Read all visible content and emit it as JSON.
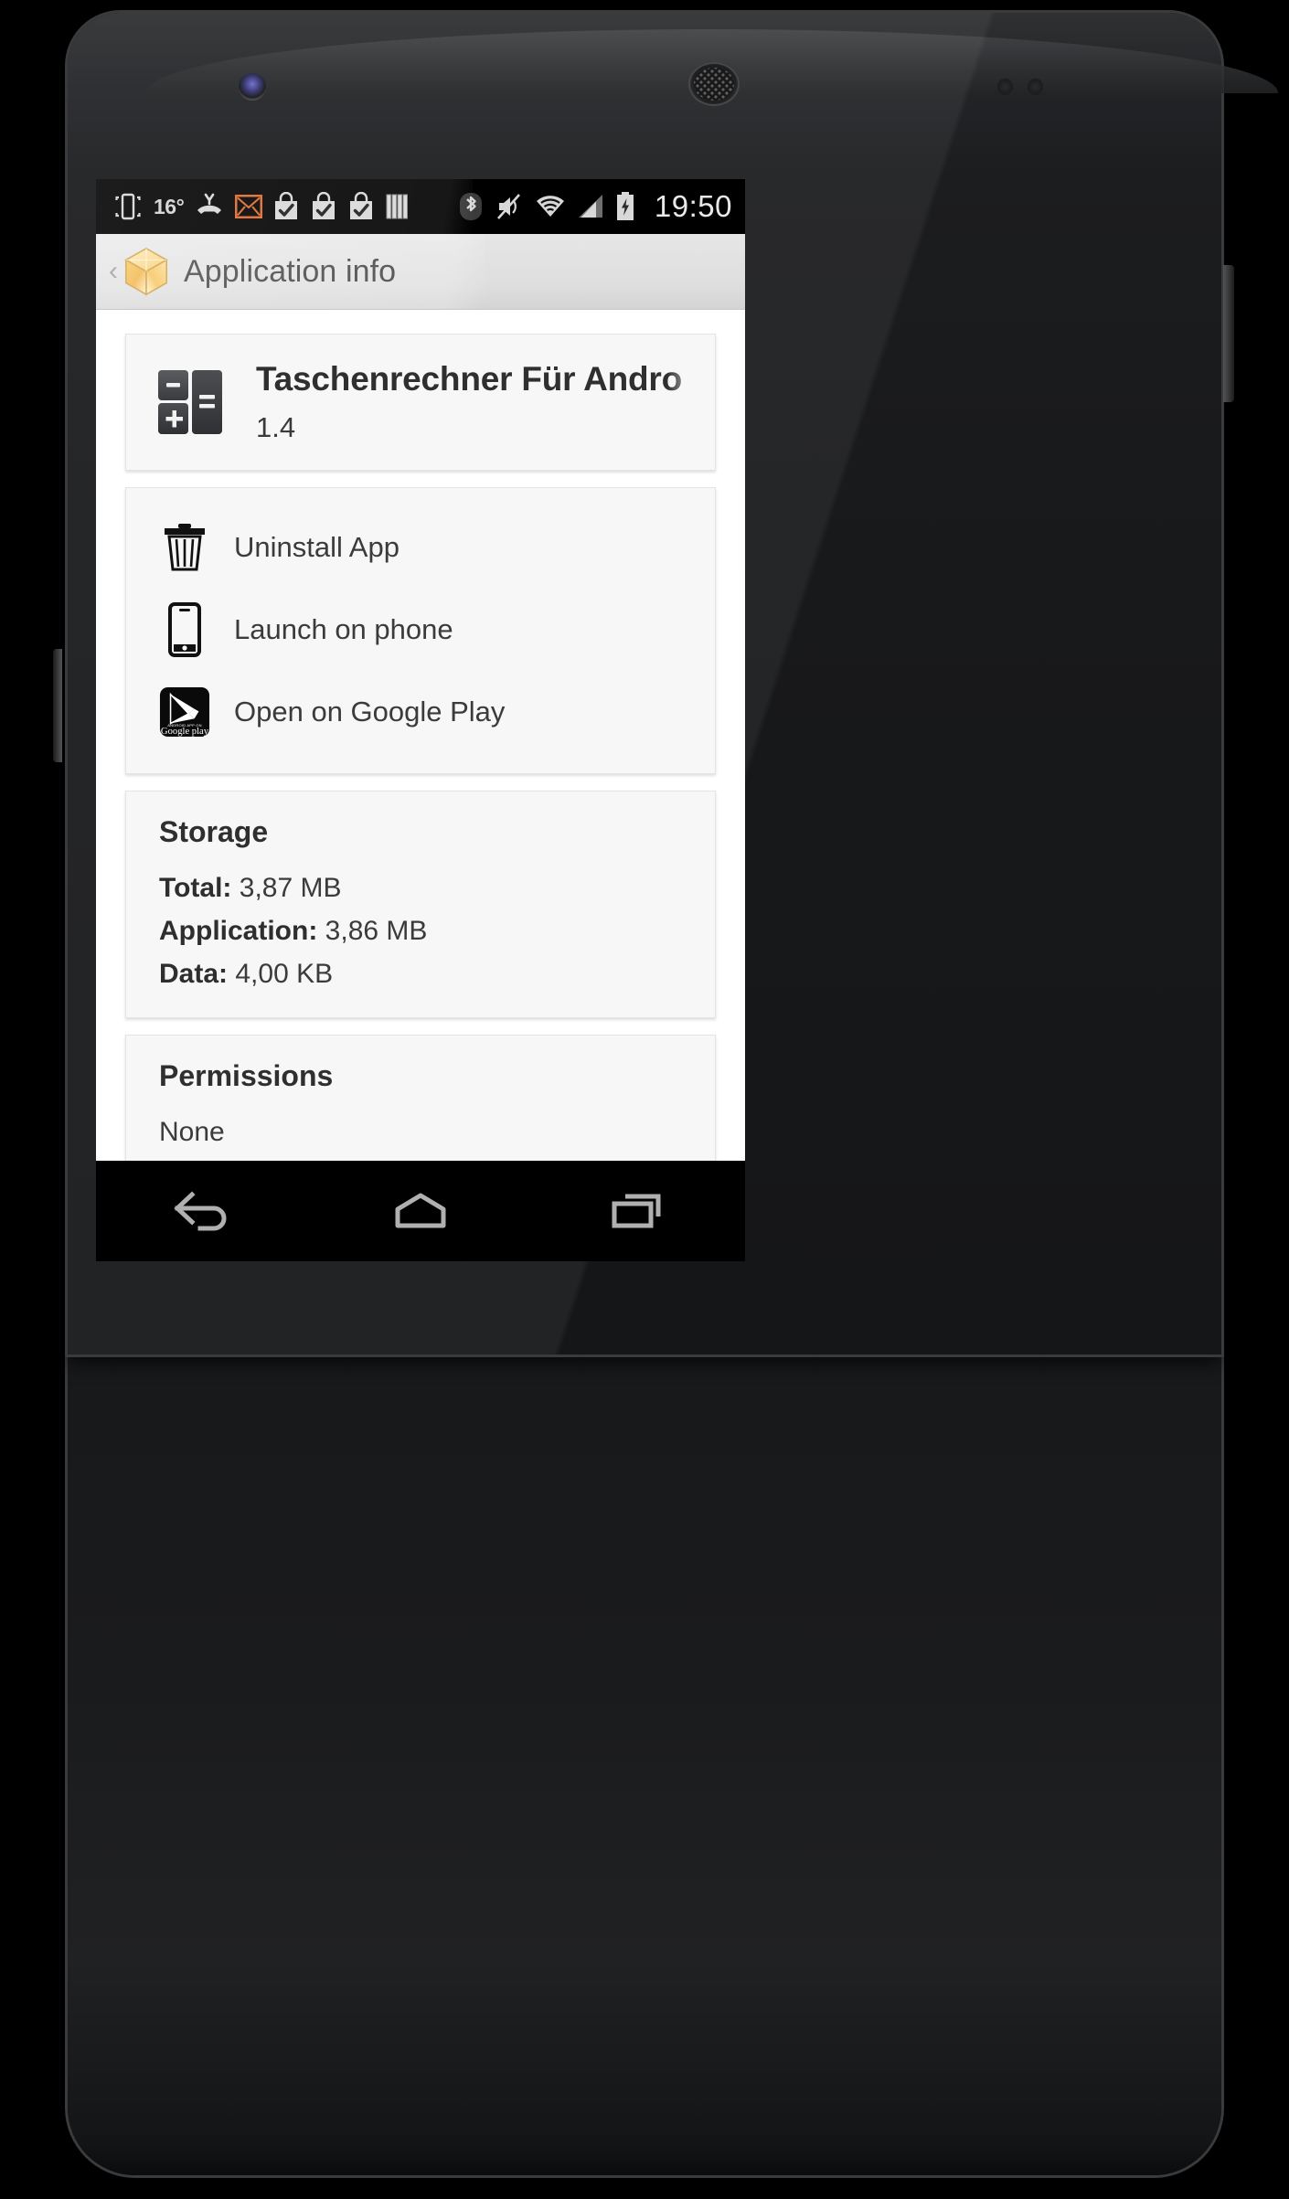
{
  "device": {
    "frame": "nexus-phone",
    "bezel_color": "#1a1b1d"
  },
  "status_bar": {
    "background": "#000000",
    "temperature": "16°",
    "clock": "19:50",
    "left_icons": [
      {
        "name": "vibrate-icon",
        "label": "Vibrate mode"
      },
      {
        "name": "temperature-text",
        "label": "16°"
      },
      {
        "name": "missed-call-icon",
        "label": "Missed call"
      },
      {
        "name": "email-icon",
        "label": "New email"
      },
      {
        "name": "play-store-update-icon",
        "label": "App update"
      },
      {
        "name": "play-store-update-icon-2",
        "label": "App update"
      },
      {
        "name": "play-store-update-icon-3",
        "label": "App update"
      },
      {
        "name": "books-icon",
        "label": "Books"
      }
    ],
    "right_icons": [
      {
        "name": "bluetooth-icon",
        "label": "Bluetooth on"
      },
      {
        "name": "mute-icon",
        "label": "Sound muted"
      },
      {
        "name": "wifi-icon",
        "label": "Wi-Fi signal"
      },
      {
        "name": "cellular-signal-icon",
        "label": "Cellular signal"
      },
      {
        "name": "battery-charging-icon",
        "label": "Battery charging"
      }
    ]
  },
  "action_bar": {
    "back_chevron": "‹",
    "app_icon": "golden-cube-icon",
    "title": "Application info",
    "accent": "#f5b942"
  },
  "app_card": {
    "icon": "calculator-icon",
    "name": "Taschenrechner Für Andro",
    "version": "1.4"
  },
  "actions": [
    {
      "icon": "trash-icon",
      "label": "Uninstall App"
    },
    {
      "icon": "phone-icon",
      "label": "Launch on phone"
    },
    {
      "icon": "google-play-icon",
      "label": "Open on Google Play"
    }
  ],
  "google_play_badge": {
    "top_line": "ANDROID APP ON",
    "bottom_line": "Google play"
  },
  "storage": {
    "title": "Storage",
    "rows": [
      {
        "label": "Total:",
        "value": "3,87 MB"
      },
      {
        "label": "Application:",
        "value": "3,86 MB"
      },
      {
        "label": "Data:",
        "value": "4,00 KB"
      }
    ]
  },
  "permissions": {
    "title": "Permissions",
    "value": "None"
  },
  "nav_bar": {
    "background": "#000000",
    "buttons": [
      {
        "name": "back-button",
        "label": "Back"
      },
      {
        "name": "home-button",
        "label": "Home"
      },
      {
        "name": "recents-button",
        "label": "Recent apps"
      }
    ]
  }
}
